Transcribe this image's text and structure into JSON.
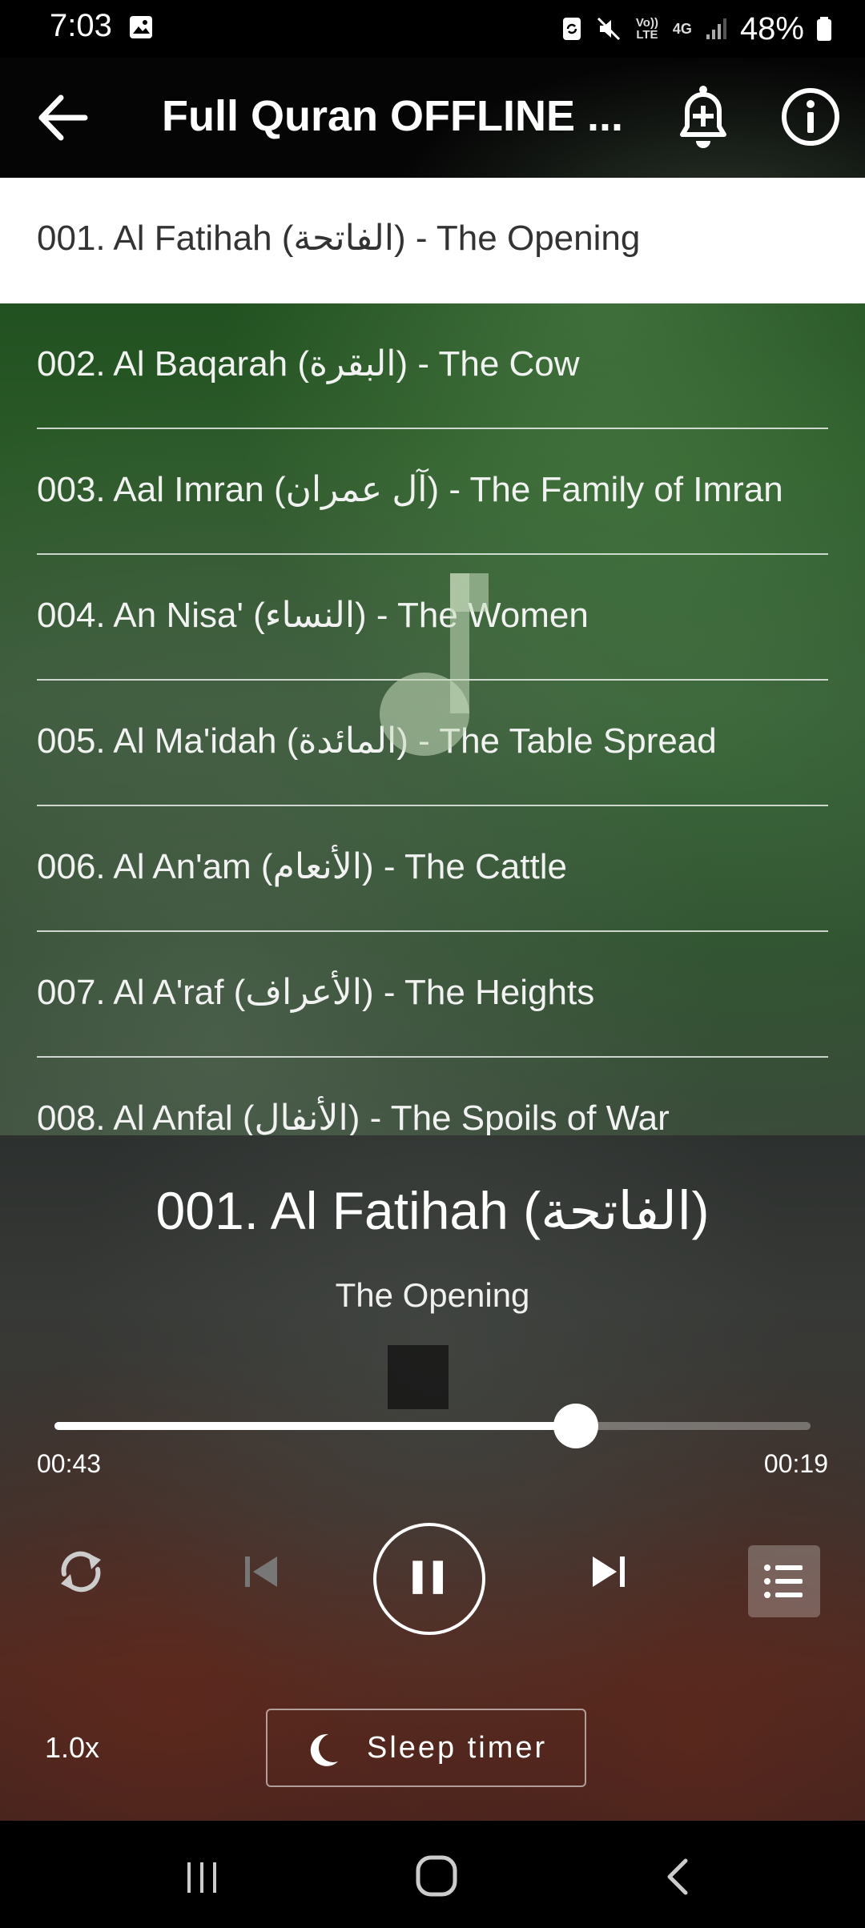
{
  "status_bar": {
    "time": "7:03",
    "volte_label": "Vo)) LTE",
    "network_label": "4G",
    "battery_percent": "48%",
    "icons": [
      "gallery-icon",
      "sync-icon",
      "mute-icon",
      "volte-icon",
      "network-4g-icon",
      "signal-icon",
      "battery-icon"
    ]
  },
  "app_bar": {
    "title": "Full Quran OFFLINE ...",
    "icons": [
      "back-arrow-icon",
      "bell-plus-icon",
      "info-icon"
    ]
  },
  "list": {
    "items": [
      {
        "label": "001. Al Fatihah (الفاتحة) - The Opening",
        "selected": true
      },
      {
        "label": "002. Al Baqarah (البقرة) - The Cow",
        "selected": false
      },
      {
        "label": "003. Aal Imran (آل عمران) - The Family of Imran",
        "selected": false
      },
      {
        "label": "004. An Nisa' (النساء) - The Women",
        "selected": false
      },
      {
        "label": "005. Al Ma'idah (المائدة) - The Table Spread",
        "selected": false
      },
      {
        "label": "006. Al An'am (الأنعام) - The Cattle",
        "selected": false
      },
      {
        "label": "007. Al A'raf (الأعراف) - The Heights",
        "selected": false
      },
      {
        "label": "008. Al Anfal (الأنفال) - The Spoils of War",
        "selected": false
      }
    ]
  },
  "player": {
    "title": "001. Al Fatihah (الفاتحة)",
    "subtitle": "The Opening",
    "elapsed": "00:43",
    "remaining": "00:19",
    "progress_fraction": 0.69,
    "speed": "1.0x",
    "sleep_timer_label": "Sleep timer",
    "icons": [
      "repeat-icon",
      "previous-icon",
      "pause-icon",
      "next-icon",
      "playlist-icon",
      "moon-icon"
    ]
  },
  "nav_bar": {
    "icons": [
      "recents-icon",
      "home-icon",
      "back-icon"
    ]
  },
  "colors": {
    "selected_row_bg": "#ffffff",
    "list_bg_green": "#2b5a28",
    "player_bg": "#373936",
    "text_primary": "#ffffff"
  }
}
